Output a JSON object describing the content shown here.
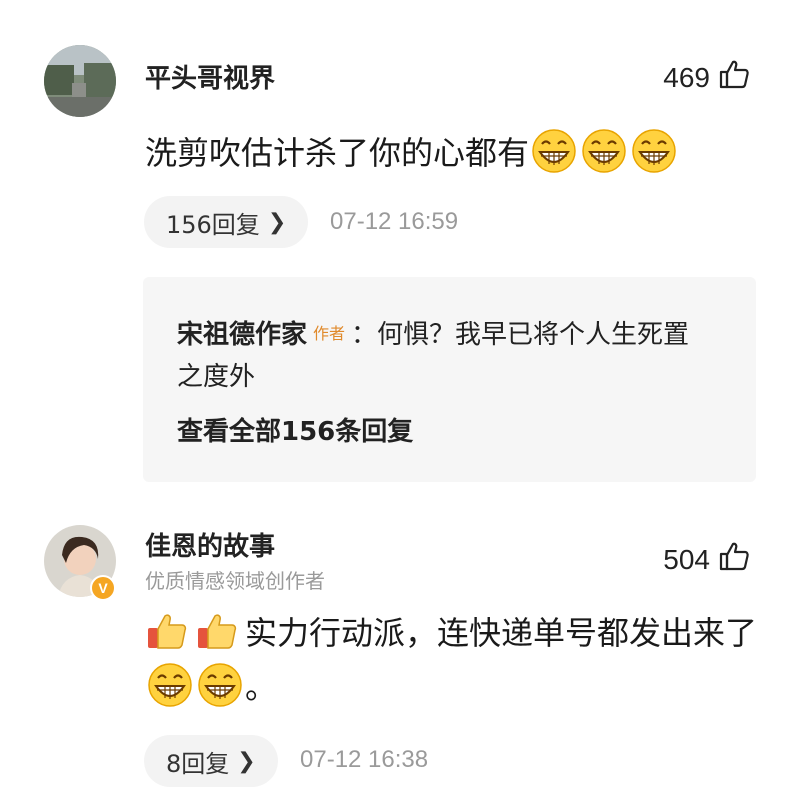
{
  "comments": [
    {
      "username": "平头哥视界",
      "likes": "469",
      "text": "洗剪吹估计杀了你的心都有",
      "emoji_count": 3,
      "reply_count_label": "156回复",
      "time": "07-12 16:59",
      "top_reply": {
        "user": "宋祖德作家",
        "tag": "作者",
        "text": "：何惧？我早已将个人生死置之度外"
      },
      "view_all_label": "查看全部156条回复"
    },
    {
      "username": "佳恩的故事",
      "subtitle": "优质情感领域创作者",
      "badge": "V",
      "likes": "504",
      "text": "实力行动派，连快递单号都发出来了",
      "text_end": "。",
      "reply_count_label": "8回复",
      "time": "07-12 16:38"
    }
  ],
  "icons": {
    "like": "thumbs-up-outline-icon",
    "reply_chevron": "chevron-right-icon",
    "emoji": "grinning-face-icon",
    "thumbs_emoji": "thumbs-up-emoji-icon"
  }
}
